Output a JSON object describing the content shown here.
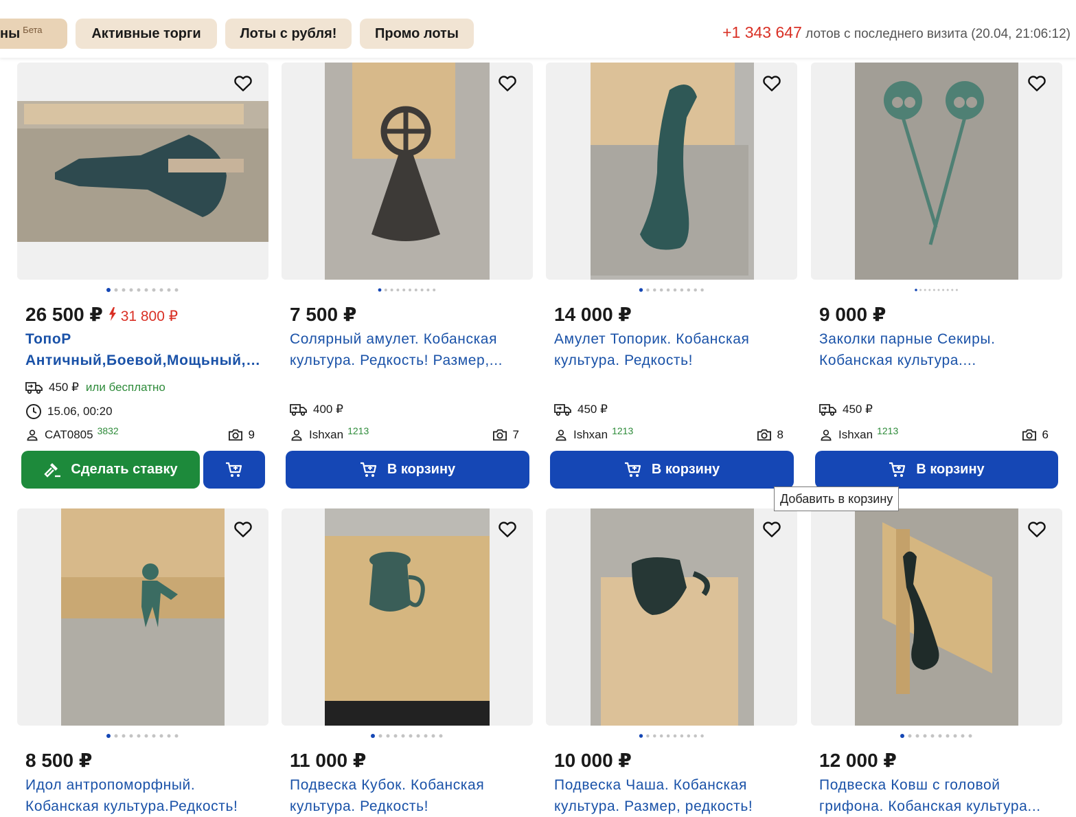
{
  "tabs": [
    {
      "label": "ны",
      "badge": "Бета"
    },
    {
      "label": "Активные торги"
    },
    {
      "label": "Лоты с рубля!"
    },
    {
      "label": "Промо лоты"
    }
  ],
  "visit": {
    "count": "+1 343 647",
    "text": "лотов с последнего визита (20.04, 21:06:12)"
  },
  "tooltip": "Добавить в корзину",
  "row1": [
    {
      "price": "26 500 ₽",
      "old_price": "31 800 ₽",
      "title1": "ТопоР",
      "title2": "Античный,Боевой,Мощьный,Т...",
      "delivery": "450 ₽",
      "delivery_alt": "или бесплатно",
      "time": "15.06, 00:20",
      "seller": "CAT0805",
      "rating": "3832",
      "photos": "9",
      "button": "Сделать ставку"
    },
    {
      "price": "7 500 ₽",
      "title1": "Солярный амулет. Кобанская",
      "title2": "культура. Редкость! Размер,...",
      "delivery": "400 ₽",
      "seller": "Ishxan",
      "rating": "1213",
      "photos": "7",
      "button": "В корзину"
    },
    {
      "price": "14 000 ₽",
      "title1": "Амулет Топорик. Кобанская",
      "title2": "культура. Редкость!",
      "delivery": "450 ₽",
      "seller": "Ishxan",
      "rating": "1213",
      "photos": "8",
      "button": "В корзину"
    },
    {
      "price": "9 000 ₽",
      "title1": "Заколки парные Секиры.",
      "title2": "Кобанская культура....",
      "delivery": "450 ₽",
      "seller": "Ishxan",
      "rating": "1213",
      "photos": "6",
      "button": "В корзину"
    }
  ],
  "row2": [
    {
      "price": "8 500 ₽",
      "title1": "Идол антропоморфный.",
      "title2": "Кобанская культура.Редкость!"
    },
    {
      "price": "11 000 ₽",
      "title1": "Подвеска Кубок. Кобанская",
      "title2": "культура. Редкость!"
    },
    {
      "price": "10 000 ₽",
      "title1": "Подвеска Чаша. Кобанская",
      "title2": "культура. Размер, редкость!"
    },
    {
      "price": "12 000 ₽",
      "title1": "Подвеска Ковш с головой",
      "title2": "грифона. Кобанская культура..."
    }
  ],
  "colors": {
    "accent_blue": "#1547b5",
    "bid_green": "#1d8a3b",
    "link_blue": "#1a52a8",
    "price_red": "#d93025",
    "tab_bg": "#f1e4d3"
  },
  "icons": [
    "heart-icon",
    "truck-icon",
    "clock-icon",
    "user-icon",
    "camera-icon",
    "cart-icon",
    "gavel-icon",
    "flash-icon"
  ]
}
